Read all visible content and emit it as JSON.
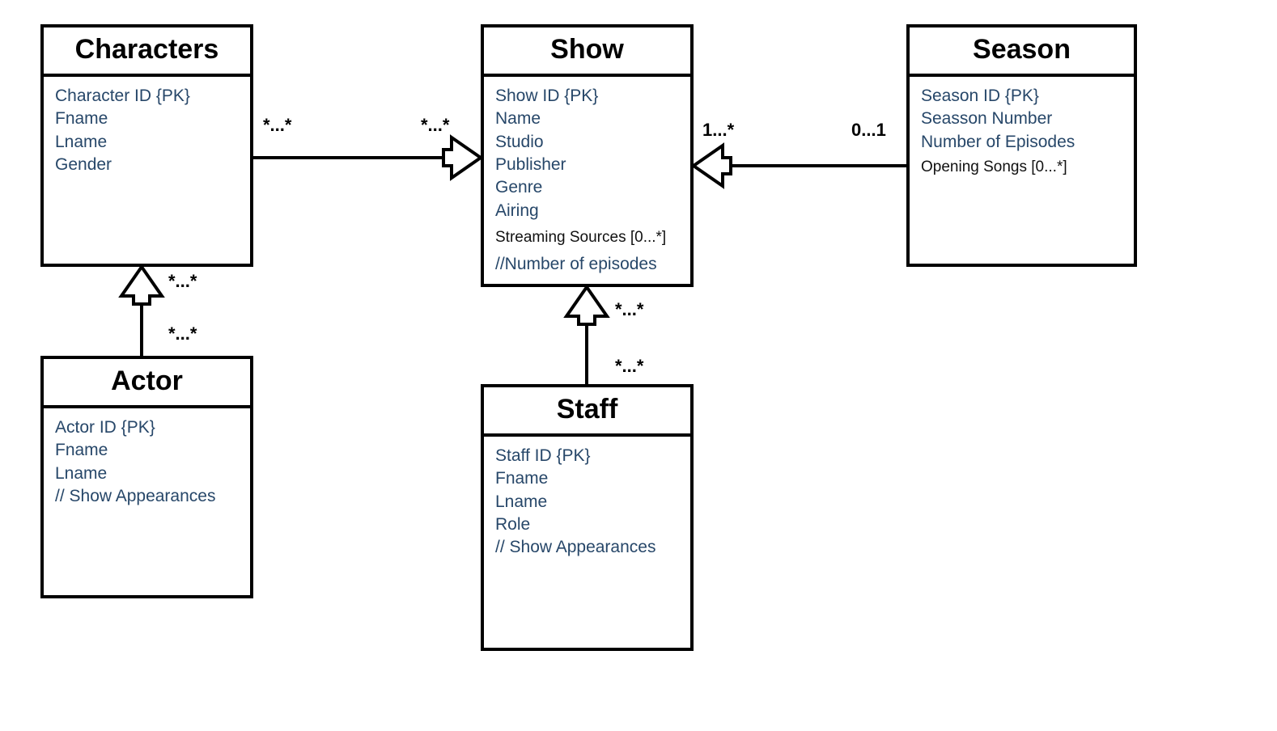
{
  "entities": {
    "characters": {
      "title": "Characters",
      "attrs": [
        "Character ID   {PK}",
        "Fname",
        "Lname",
        "Gender"
      ]
    },
    "show": {
      "title": "Show",
      "attrs": [
        "Show ID   {PK}",
        "Name",
        "Studio",
        "Publisher",
        "Genre",
        "Airing"
      ],
      "extra1": "Streaming Sources  [0...*]",
      "extra2": "//Number of episodes"
    },
    "season": {
      "title": "Season",
      "attrs": [
        "Season ID   {PK}",
        "Seasson Number",
        "Number of Episodes"
      ],
      "extra1": "Opening Songs  [0...*]"
    },
    "actor": {
      "title": "Actor",
      "attrs": [
        "Actor ID   {PK}",
        "Fname",
        "Lname",
        "//  Show Appearances"
      ]
    },
    "staff": {
      "title": "Staff",
      "attrs": [
        "Staff ID   {PK}",
        "Fname",
        "Lname",
        "Role",
        "//  Show Appearances"
      ]
    }
  },
  "multiplicities": {
    "char_show_left": "*...*",
    "char_show_right": "*...*",
    "actor_char_top": "*...*",
    "actor_char_bottom": "*...*",
    "staff_show_top": "*...*",
    "staff_show_bottom": "*...*",
    "season_show_left": "1...*",
    "season_show_right": "0...1"
  }
}
